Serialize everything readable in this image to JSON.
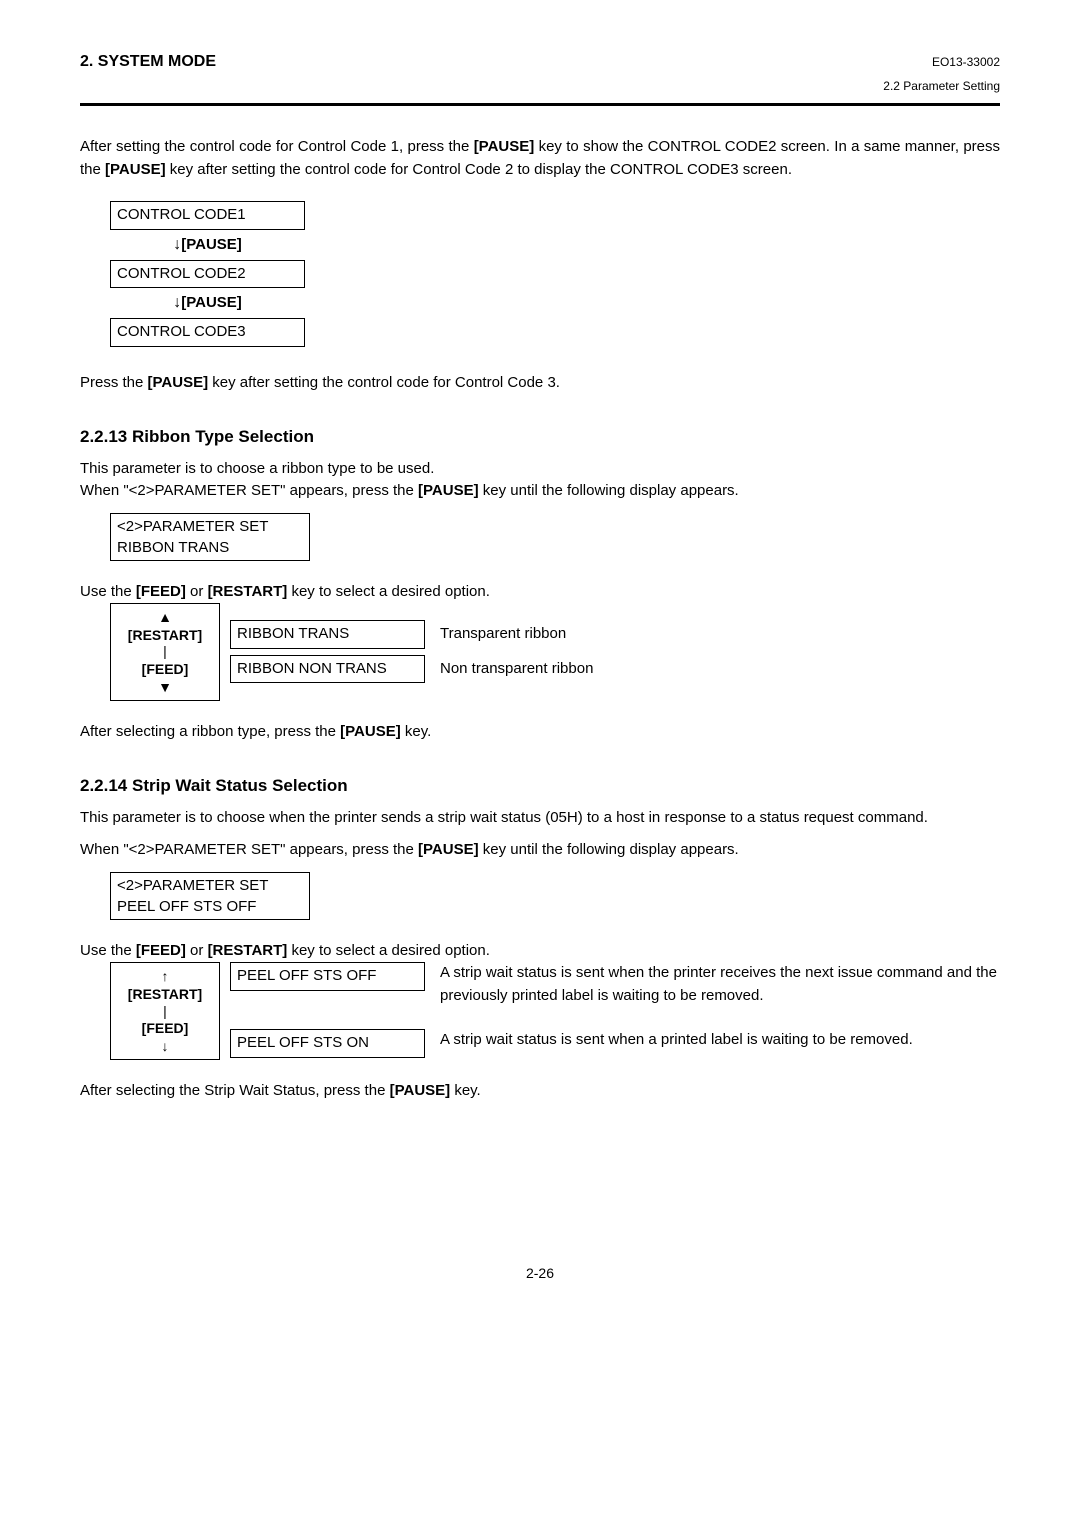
{
  "header": {
    "title": "2. SYSTEM MODE",
    "code": "EO13-33002",
    "section": "2.2 Parameter Setting"
  },
  "intro": {
    "para1": "After setting the control code for Control Code 1, press the [PAUSE] key to show the CONTROL CODE2 screen.  In a same manner, press the [PAUSE] key after setting the control code for Control Code 2 to display the CONTROL CODE3 screen."
  },
  "flow": {
    "box1": "CONTROL CODE1",
    "step1": "[PAUSE]",
    "box2": "CONTROL CODE2",
    "step2": "[PAUSE]",
    "box3": "CONTROL CODE3"
  },
  "after_flow": "Press the [PAUSE] key after setting the control code for Control Code 3.",
  "section13": {
    "heading": "2.2.13  Ribbon Type Selection",
    "para1": "This parameter is to choose a ribbon type to be used.",
    "para2": "When \"<2>PARAMETER SET\" appears, press the [PAUSE] key until the following display appears.",
    "box_line1": "<2>PARAMETER SET",
    "box_line2": "RIBBON  TRANS",
    "instruction": "Use the [FEED] or [RESTART] key to select a desired option.",
    "nav1": "[RESTART]",
    "nav2": "[FEED]",
    "opt1": "RIBBON  TRANS",
    "opt1_desc": "Transparent ribbon",
    "opt2": "RIBBON  NON TRANS",
    "opt2_desc": "Non transparent ribbon",
    "after": "After selecting a ribbon type, press the [PAUSE] key."
  },
  "section14": {
    "heading": "2.2.14  Strip Wait Status Selection",
    "para1": "This parameter is to choose when the printer sends a strip wait status (05H) to a host in response to a status request command.",
    "para2": "When \"<2>PARAMETER SET\" appears, press the [PAUSE] key until the following display appears.",
    "box_line1": "<2>PARAMETER SET",
    "box_line2": "PEEL OFF STS OFF",
    "instruction": "Use the [FEED] or [RESTART] key to select a desired option.",
    "nav1": "[RESTART]",
    "nav2": "[FEED]",
    "opt1": "PEEL OFF STS OFF",
    "opt1_desc": "A strip wait status is sent when the printer receives the next issue command and the previously printed label is waiting to be removed.",
    "opt2": "PEEL OFF STS ON",
    "opt2_desc": "A strip wait status is sent when a printed label is waiting to be removed.",
    "after": "After selecting the Strip Wait Status, press the [PAUSE] key."
  },
  "page_number": "2-26"
}
